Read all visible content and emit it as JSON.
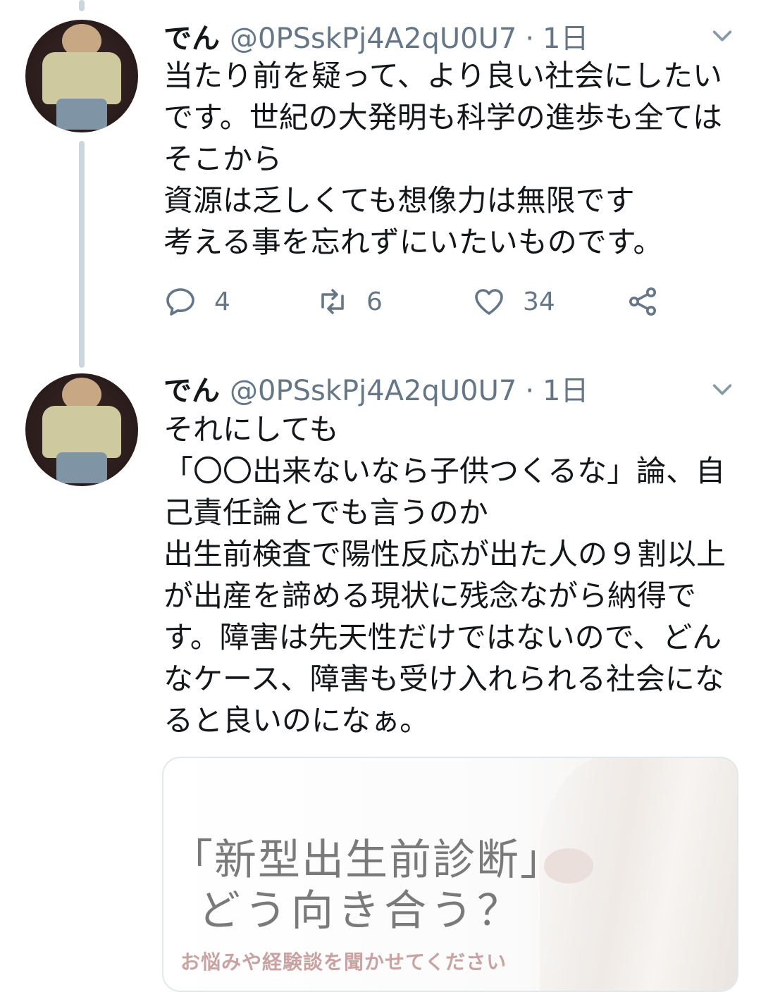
{
  "tweets": [
    {
      "name": "でん",
      "handle": "@0PSskPj4A2qU0U7",
      "separator": "·",
      "time": "1日",
      "text": "当たり前を疑って、より良い社会にしたいです。世紀の大発明も科学の進歩も全てはそこから\n資源は乏しくても想像力は無限です\n考える事を忘れずにいたいものです。",
      "replies": "4",
      "retweets": "6",
      "likes": "34"
    },
    {
      "name": "でん",
      "handle": "@0PSskPj4A2qU0U7",
      "separator": "·",
      "time": "1日",
      "text": "それにしても\n「〇〇出来ないなら子供つくるな」論、自己責任論とでも言うのか\n出生前検査で陽性反応が出た人の９割以上が出産を諦める現状に残念ながら納得です。障害は先天性だけではないので、どんなケース、障害も受け入れられる社会になると良いのになぁ。",
      "card": {
        "title": "「新型出生前診断」",
        "subtitle": "どう向き合う？",
        "caption": "お悩みや経験談を聞かせてください"
      }
    }
  ],
  "icons": {
    "reply": "reply-icon",
    "retweet": "retweet-icon",
    "like": "heart-icon",
    "share": "share-icon",
    "menu": "chevron-down-icon"
  },
  "colors": {
    "text": "#14171a",
    "secondary": "#657786",
    "thread_line": "#ccd6dd",
    "card_border": "#e1e8ed"
  }
}
